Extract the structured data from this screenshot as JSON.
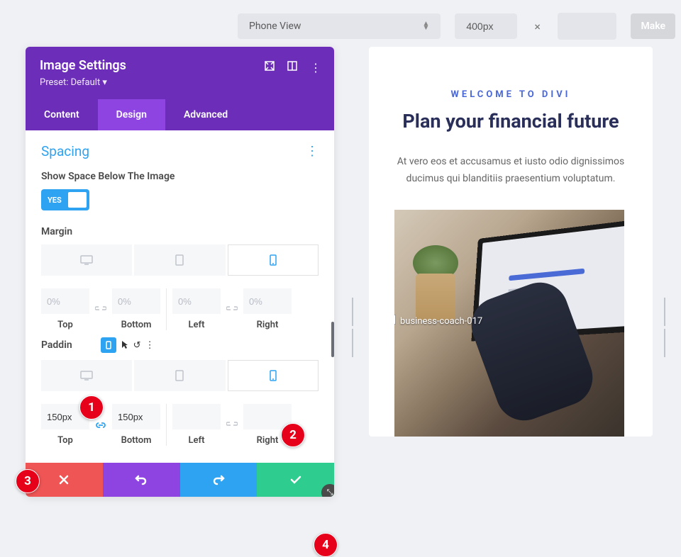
{
  "topbar": {
    "view_mode": "Phone View",
    "width_value": "400px",
    "close_x": "×",
    "make_label": "Make"
  },
  "panel": {
    "title": "Image Settings",
    "preset": "Preset: Default ▾",
    "tabs": {
      "content": "Content",
      "design": "Design",
      "advanced": "Advanced"
    },
    "section": "Spacing",
    "space_below_label": "Show Space Below The Image",
    "toggle_text": "YES",
    "margin_label": "Margin",
    "padding_label": "Paddin",
    "margin": {
      "top": {
        "placeholder": "0%",
        "label": "Top"
      },
      "bottom": {
        "placeholder": "0%",
        "label": "Bottom"
      },
      "left": {
        "placeholder": "0%",
        "label": "Left"
      },
      "right": {
        "placeholder": "0%",
        "label": "Right"
      }
    },
    "padding": {
      "top": {
        "value": "150px",
        "label": "Top"
      },
      "bottom": {
        "value": "150px",
        "label": "Bottom"
      },
      "left": {
        "value": "",
        "label": "Left"
      },
      "right": {
        "value": "",
        "label": "Right"
      }
    }
  },
  "preview": {
    "overline": "WELCOME TO DIVI",
    "heading": "Plan your financial future",
    "body": "At vero eos et accusamus et iusto odio dignissimos ducimus qui blanditiis praesentium voluptatum.",
    "image_label": "business-coach-017"
  },
  "markers": {
    "m1": "1",
    "m2": "2",
    "m3": "3",
    "m4": "4"
  }
}
